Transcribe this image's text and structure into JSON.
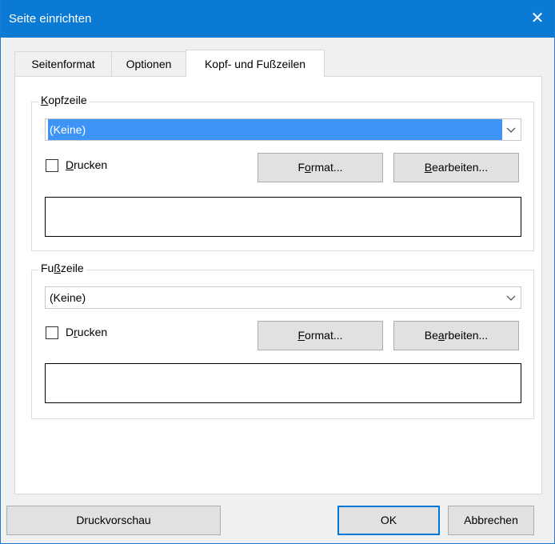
{
  "window": {
    "title": "Seite einrichten",
    "close_glyph": "✕"
  },
  "tabs": [
    {
      "label": "Seitenformat",
      "active": false
    },
    {
      "label": "Optionen",
      "active": false
    },
    {
      "label": "Kopf- und Fußzeilen",
      "active": true
    }
  ],
  "header_group": {
    "legend_pre": "",
    "legend_mn": "K",
    "legend_post": "opfzeile",
    "combo_value": "(Keine)",
    "print_pre": "",
    "print_mn": "D",
    "print_post": "rucken",
    "print_checked": false,
    "format_pre": "F",
    "format_mn": "o",
    "format_post": "rmat...",
    "edit_pre": "",
    "edit_mn": "B",
    "edit_post": "earbeiten..."
  },
  "footer_group": {
    "legend_pre": "Fu",
    "legend_mn": "ß",
    "legend_post": "zeile",
    "combo_value": "(Keine)",
    "print_pre": "D",
    "print_mn": "r",
    "print_post": "ucken",
    "print_checked": false,
    "format_pre": "",
    "format_mn": "F",
    "format_post": "ormat...",
    "edit_pre": "Be",
    "edit_mn": "a",
    "edit_post": "rbeiten..."
  },
  "buttons": {
    "preview": "Druckvorschau",
    "ok": "OK",
    "cancel": "Abbrechen"
  },
  "colors": {
    "titlebar": "#0a7ad4",
    "selection": "#3d94f6",
    "default_border": "#0078d7"
  }
}
